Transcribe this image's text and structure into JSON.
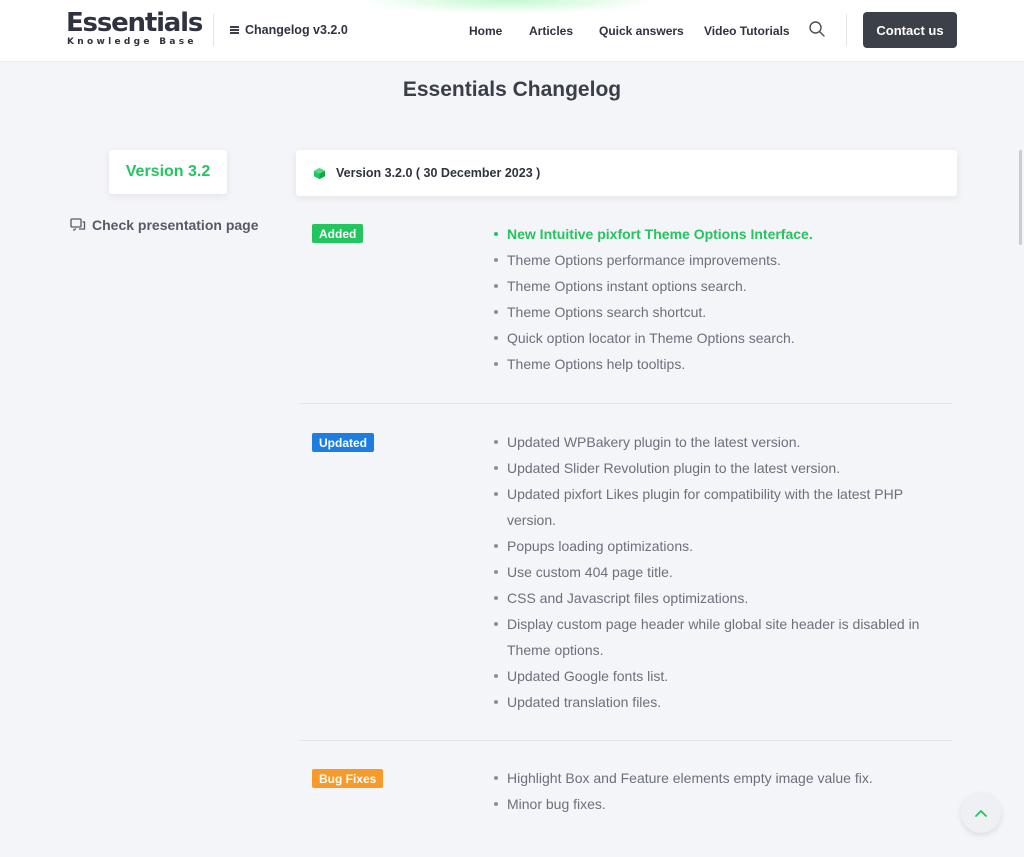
{
  "header": {
    "logo_main": "Essentials",
    "logo_sub": "Knowledge Base",
    "changelog_menu": "Changelog v3.2.0",
    "nav": [
      {
        "label": "Home"
      },
      {
        "label": "Articles"
      },
      {
        "label": "Quick answers"
      },
      {
        "label": "Video Tutorials"
      }
    ],
    "contact_label": "Contact us"
  },
  "page_title": "Essentials Changelog",
  "sidebar": {
    "version_label": "Version 3.2",
    "presentation_link": "Check presentation page"
  },
  "version_header": "Version 3.2.0 ( 30 December 2023 )",
  "sections": {
    "added": {
      "badge": "Added",
      "items": [
        "New Intuitive pixfort Theme Options Interface.",
        "Theme Options performance improvements.",
        "Theme Options instant options search.",
        "Theme Options search shortcut.",
        "Quick option locator in Theme Options search.",
        "Theme Options help tooltips."
      ]
    },
    "updated": {
      "badge": "Updated",
      "items": [
        "Updated WPBakery plugin to the latest version.",
        "Updated Slider Revolution plugin to the latest version.",
        "Updated pixfort Likes plugin for compatibility with the latest PHP version.",
        "Popups loading optimizations.",
        "Use custom 404 page title.",
        "CSS and Javascript files optimizations.",
        "Display custom page header while global site header is disabled in Theme options.",
        "Updated Google fonts list.",
        "Updated translation files."
      ]
    },
    "bugfixes": {
      "badge": "Bug Fixes",
      "items": [
        "Highlight Box and Feature elements empty image value fix.",
        "Minor bug fixes."
      ]
    }
  },
  "colors": {
    "accent_green": "#22c55e",
    "updated_blue": "#1d7ee0",
    "bugfix_orange": "#f59a2b",
    "dark_button": "#3c4048"
  },
  "icons": {
    "menu": "hamburger-icon",
    "search": "search-icon",
    "presentation": "chat-bubbles-icon",
    "version": "cube-icon",
    "scroll_top": "chevron-up-icon"
  }
}
